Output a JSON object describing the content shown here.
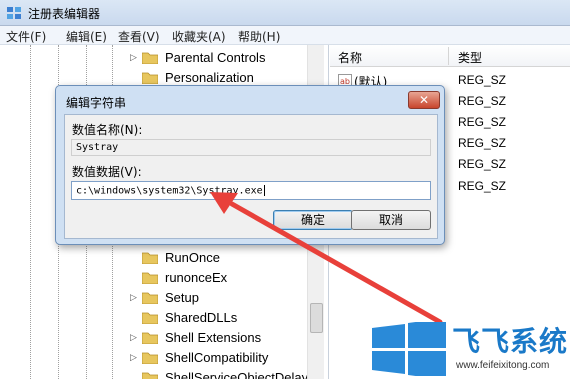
{
  "window": {
    "title": "注册表编辑器"
  },
  "menu": [
    "文件(F)",
    "编辑(E)",
    "查看(V)",
    "收藏夹(A)",
    "帮助(H)"
  ],
  "tree": {
    "top_items": [
      {
        "label": "Parental Controls",
        "expandable": true
      },
      {
        "label": "Personalization",
        "expandable": false
      }
    ],
    "bottom_items": [
      {
        "label": "RunOnce",
        "expandable": false
      },
      {
        "label": "runonceEx",
        "expandable": false
      },
      {
        "label": "Setup",
        "expandable": true
      },
      {
        "label": "SharedDLLs",
        "expandable": false
      },
      {
        "label": "Shell Extensions",
        "expandable": true
      },
      {
        "label": "ShellCompatibility",
        "expandable": true
      },
      {
        "label": "ShellServiceObjectDelayl",
        "expandable": false
      }
    ]
  },
  "list": {
    "col_name": "名称",
    "col_type": "类型",
    "rows": [
      {
        "name": "(默认)",
        "type": "REG_SZ"
      },
      {
        "name": "",
        "type": "REG_SZ"
      },
      {
        "name": "",
        "type": "REG_SZ"
      },
      {
        "name": "",
        "type": "REG_SZ"
      },
      {
        "name": "",
        "type": "REG_SZ"
      },
      {
        "name": "",
        "type": "REG_SZ"
      }
    ]
  },
  "dialog": {
    "title": "编辑字符串",
    "close": "✕",
    "name_label": "数值名称(N):",
    "name_value": "Systray",
    "data_label": "数值数据(V):",
    "data_value": "c:\\windows\\system32\\Systray.exe",
    "ok": "确定",
    "cancel": "取消"
  },
  "watermark": {
    "text": "飞飞系统",
    "url": "www.feifeixitong.com"
  },
  "colors": {
    "accent": "#1a79c8",
    "arrow": "#e8403a"
  }
}
